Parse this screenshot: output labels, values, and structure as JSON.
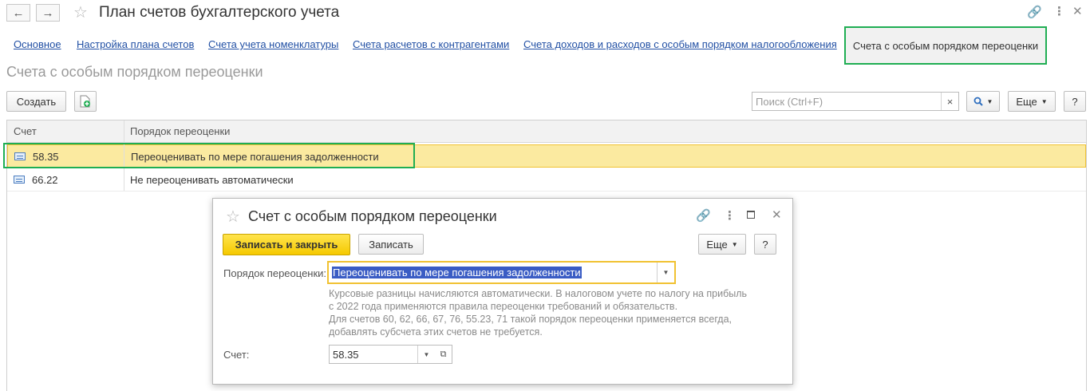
{
  "window": {
    "back_glyph": "←",
    "forward_glyph": "→",
    "title": "План счетов бухгалтерского учета"
  },
  "links": [
    {
      "label": "Основное"
    },
    {
      "label": "Настройка плана счетов"
    },
    {
      "label": "Счета учета номенклатуры"
    },
    {
      "label": "Счета расчетов с контрагентами"
    },
    {
      "label": "Счета доходов и расходов с особым порядком налогообложения"
    }
  ],
  "active_link": "Счета с особым порядком переоценки",
  "page_subtitle": "Счета с особым порядком переоценки",
  "toolbar": {
    "create_label": "Создать",
    "search_placeholder": "Поиск (Ctrl+F)",
    "search_clear": "×",
    "more_label": "Еще",
    "help_label": "?"
  },
  "table": {
    "columns": [
      "Счет",
      "Порядок переоценки"
    ],
    "rows": [
      {
        "account": "58.35",
        "order": "Переоценивать по мере погашения задолженности",
        "selected": true
      },
      {
        "account": "66.22",
        "order": "Не переоценивать автоматически",
        "selected": false
      }
    ]
  },
  "dialog": {
    "title": "Счет с особым порядком переоценки",
    "save_close_label": "Записать и закрыть",
    "save_label": "Записать",
    "more_label": "Еще",
    "help_label": "?",
    "order_label": "Порядок переоценки:",
    "order_value": "Переоценивать по мере погашения задолженности",
    "note_lines": [
      "Курсовые разницы начисляются автоматически. В налоговом учете по налогу на прибыль",
      "с 2022 года применяются правила переоценки требований и обязательств.",
      "Для счетов 60, 62, 66, 67, 76, 55.23, 71 такой порядок переоценки применяется всегда,",
      "добавлять субсчета этих счетов не требуется."
    ],
    "account_label": "Счет:",
    "account_value": "58.35"
  },
  "colors": {
    "accent_green": "#1fae53",
    "primary_yellow": "#f5c900",
    "link_blue": "#2250a4",
    "selection": "#fbeaa0"
  }
}
